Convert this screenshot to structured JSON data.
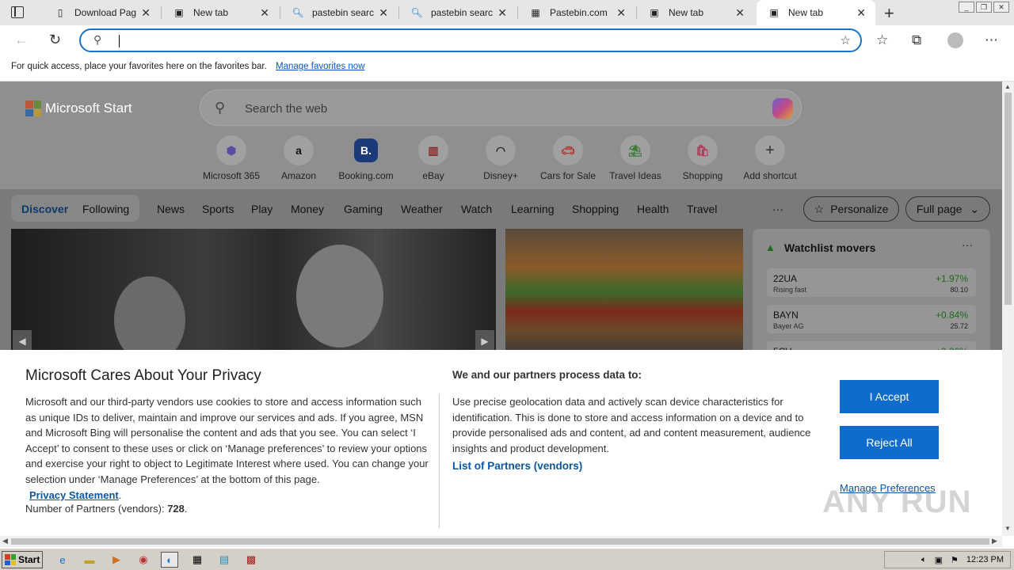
{
  "tabs": [
    {
      "label": "Download Pag",
      "icon": "page-icon"
    },
    {
      "label": "New tab",
      "icon": "newtab-icon"
    },
    {
      "label": "pastebin searc",
      "icon": "search-icon"
    },
    {
      "label": "pastebin searc",
      "icon": "search-icon"
    },
    {
      "label": "Pastebin.com",
      "icon": "pastebin-icon"
    },
    {
      "label": "New tab",
      "icon": "newtab-icon"
    },
    {
      "label": "New tab",
      "icon": "newtab-icon"
    }
  ],
  "address_bar": {
    "value": "",
    "placeholder": ""
  },
  "favorites_bar": {
    "message": "For quick access, place your favorites here on the favorites bar.",
    "link": "Manage favorites now"
  },
  "start_page": {
    "brand": "Microsoft Start",
    "search_placeholder": "Search the web",
    "shortcuts": [
      {
        "label": "Microsoft 365",
        "icon": "m365-icon"
      },
      {
        "label": "Amazon",
        "icon": "amazon-icon"
      },
      {
        "label": "Booking.com",
        "icon": "booking-icon"
      },
      {
        "label": "eBay",
        "icon": "ebay-icon"
      },
      {
        "label": "Disney+",
        "icon": "disney-icon"
      },
      {
        "label": "Cars for Sale",
        "icon": "car-icon"
      },
      {
        "label": "Travel Ideas",
        "icon": "travel-icon"
      },
      {
        "label": "Shopping",
        "icon": "shopping-icon"
      },
      {
        "label": "Add shortcut",
        "icon": "plus-icon"
      }
    ],
    "nav": {
      "discover": "Discover",
      "following": "Following",
      "items": [
        "News",
        "Sports",
        "Play",
        "Money",
        "Gaming",
        "Weather",
        "Watch",
        "Learning",
        "Shopping",
        "Health",
        "Travel"
      ],
      "more": "···",
      "personalize": "Personalize",
      "full_page": "Full page"
    },
    "watchlist": {
      "title": "Watchlist movers",
      "stocks": [
        {
          "symbol": "22UA",
          "sub": "Rising fast",
          "change": "+1.97%",
          "price": "80.10"
        },
        {
          "symbol": "BAYN",
          "sub": "Bayer AG",
          "change": "+0.84%",
          "price": "25.72"
        },
        {
          "symbol": "5CV",
          "sub": "",
          "change": "+0.26%",
          "price": ""
        }
      ]
    }
  },
  "privacy": {
    "title": "Microsoft Cares About Your Privacy",
    "body": "Microsoft and our third-party vendors use cookies to store and access information such as unique IDs to deliver, maintain and improve our services and ads. If you agree, MSN and Microsoft Bing will personalise the content and ads that you see. You can select ‘I Accept’ to consent to these uses or click on ‘Manage preferences’ to review your options and exercise your right to object to Legitimate Interest where used.  You can change your selection under ‘Manage Preferences’ at the bottom of this page.",
    "privacy_link": "Privacy Statement",
    "partners_count_label": "Number of Partners (vendors):",
    "partners_count": "728",
    "process_title": "We and our partners process data to:",
    "process_body": "Use precise geolocation data and actively scan device characteristics for identification. This is done to store and access information on a device and to provide personalised ads and content, ad and content measurement, audience insights and product development.",
    "partners_link": "List of Partners (vendors)",
    "accept": "I Accept",
    "reject": "Reject All",
    "manage": "Manage Preferences"
  },
  "watermark": "ANY RUN",
  "taskbar": {
    "start": "Start",
    "time": "12:23 PM"
  },
  "colors": {
    "accent": "#0d6ccc",
    "link": "#0b57a0",
    "positive": "#1d6b1d"
  }
}
